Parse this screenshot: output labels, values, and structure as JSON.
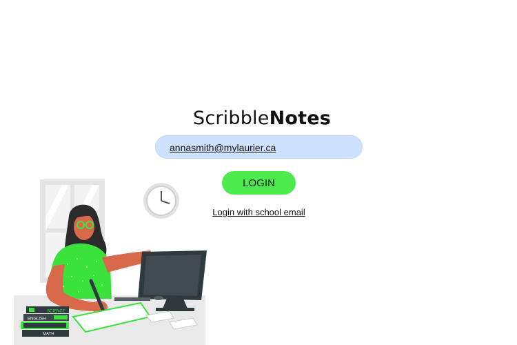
{
  "brand": {
    "name_regular": "Scribble",
    "name_bold": "Notes"
  },
  "login_form": {
    "email_value": "annasmith@mylaurier.ca",
    "login_button_label": "LOGIN",
    "school_email_link": "Login with school email"
  },
  "illustration": {
    "book_labels": [
      "SCIENCE",
      "ENGLISH",
      "MATH"
    ]
  },
  "colors": {
    "input_bg": "#cfe2fd",
    "button_bg": "#4cea4c",
    "accent_green": "#3be23b",
    "skin": "#d9694b",
    "monitor": "#2f3a3e"
  }
}
